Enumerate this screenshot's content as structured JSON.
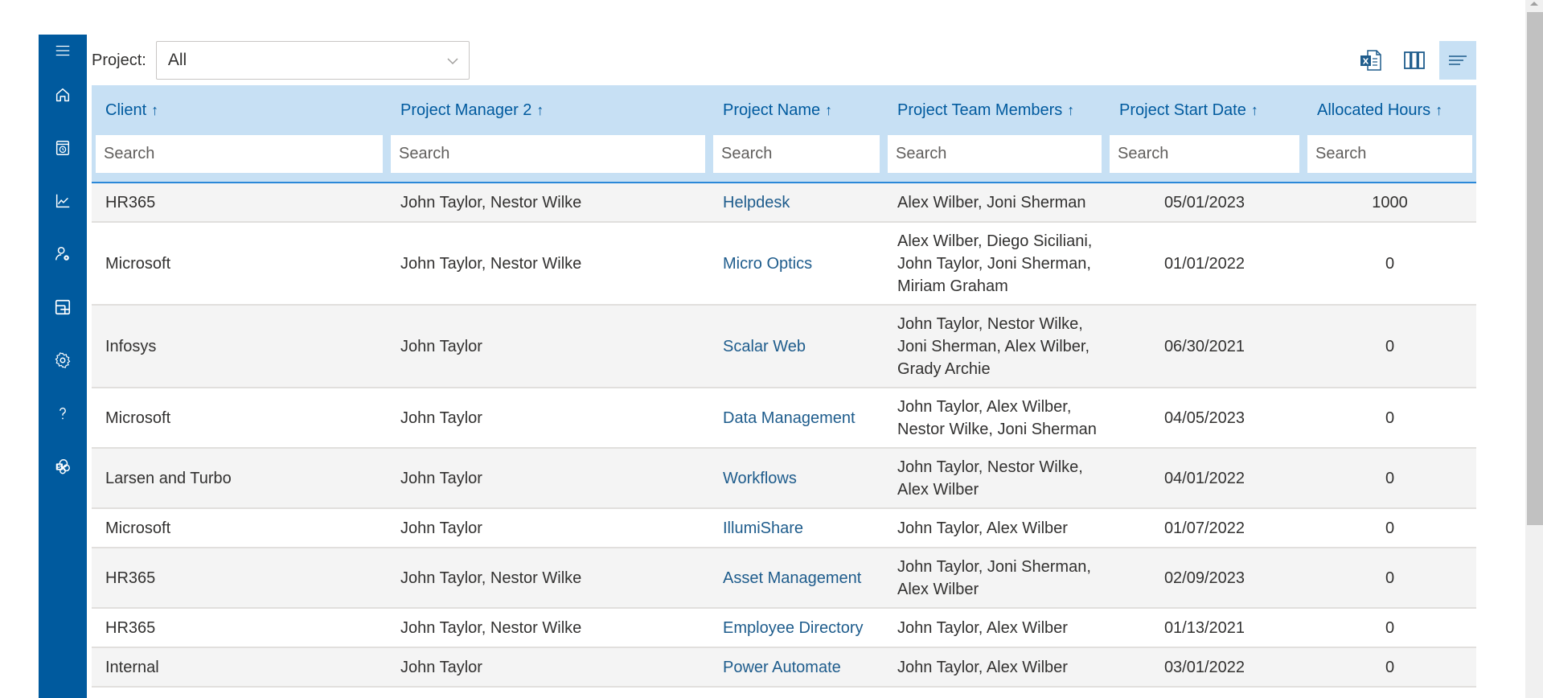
{
  "sidebar": {
    "color": "#005a9e",
    "items": [
      {
        "name": "menu",
        "icon": "hamburger-menu-icon"
      },
      {
        "name": "home",
        "icon": "home-icon"
      },
      {
        "name": "timesheet",
        "icon": "timesheet-clock-icon"
      },
      {
        "name": "reports",
        "icon": "line-chart-icon"
      },
      {
        "name": "user-settings",
        "icon": "user-gear-icon"
      },
      {
        "name": "projects",
        "icon": "project-board-icon"
      },
      {
        "name": "settings",
        "icon": "gear-icon"
      },
      {
        "name": "help",
        "icon": "help-icon"
      },
      {
        "name": "sharepoint",
        "icon": "sharepoint-icon"
      }
    ]
  },
  "filter": {
    "label": "Project:",
    "selected": "All"
  },
  "toolbar": {
    "export_excel": "excel-export-icon",
    "columns": "columns-icon",
    "list_view": "list-view-icon"
  },
  "grid": {
    "sort_arrow": "↑",
    "search_placeholder": "Search",
    "columns": [
      {
        "label": "Client"
      },
      {
        "label": "Project Manager 2"
      },
      {
        "label": "Project Name"
      },
      {
        "label": "Project Team Members"
      },
      {
        "label": "Project Start Date"
      },
      {
        "label": "Allocated Hours"
      }
    ],
    "rows": [
      {
        "client": "HR365",
        "manager": "John Taylor, Nestor Wilke",
        "project": "Helpdesk",
        "team": "Alex Wilber, Joni Sherman",
        "start": "05/01/2023",
        "hours": "1000"
      },
      {
        "client": "Microsoft",
        "manager": "John Taylor, Nestor Wilke",
        "project": "Micro Optics",
        "team": "Alex Wilber, Diego Siciliani, John Taylor, Joni Sherman, Miriam Graham",
        "start": "01/01/2022",
        "hours": "0"
      },
      {
        "client": "Infosys",
        "manager": "John Taylor",
        "project": "Scalar Web",
        "team": "John Taylor, Nestor Wilke, Joni Sherman, Alex Wilber, Grady Archie",
        "start": "06/30/2021",
        "hours": "0"
      },
      {
        "client": "Microsoft",
        "manager": "John Taylor",
        "project": "Data Management",
        "team": "John Taylor, Alex Wilber, Nestor Wilke, Joni Sherman",
        "start": "04/05/2023",
        "hours": "0"
      },
      {
        "client": "Larsen and Turbo",
        "manager": "John Taylor",
        "project": "Workflows",
        "team": "John Taylor, Nestor Wilke, Alex Wilber",
        "start": "04/01/2022",
        "hours": "0"
      },
      {
        "client": "Microsoft",
        "manager": "John Taylor",
        "project": "IllumiShare",
        "team": "John Taylor, Alex Wilber",
        "start": "01/07/2022",
        "hours": "0"
      },
      {
        "client": "HR365",
        "manager": "John Taylor, Nestor Wilke",
        "project": "Asset Management",
        "team": "John Taylor, Joni Sherman, Alex Wilber",
        "start": "02/09/2023",
        "hours": "0"
      },
      {
        "client": "HR365",
        "manager": "John Taylor, Nestor Wilke",
        "project": "Employee Directory",
        "team": "John Taylor, Alex Wilber",
        "start": "01/13/2021",
        "hours": "0"
      },
      {
        "client": "Internal",
        "manager": "John Taylor",
        "project": "Power Automate",
        "team": "John Taylor, Alex Wilber",
        "start": "03/01/2022",
        "hours": "0"
      }
    ]
  }
}
